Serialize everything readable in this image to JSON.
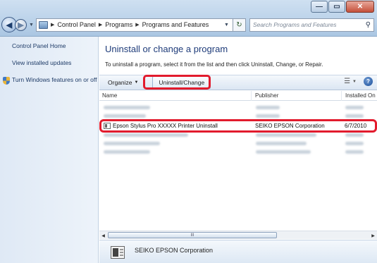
{
  "window": {
    "minimize": "—",
    "maximize": "▭",
    "close": "✕"
  },
  "address": {
    "crumbs": [
      "Control Panel",
      "Programs",
      "Programs and Features"
    ],
    "search_placeholder": "Search Programs and Features"
  },
  "sidebar": {
    "home": "Control Panel Home",
    "updates": "View installed updates",
    "features": "Turn Windows features on or off"
  },
  "main": {
    "heading": "Uninstall or change a program",
    "description": "To uninstall a program, select it from the list and then click Uninstall, Change, or Repair."
  },
  "toolbar": {
    "organize": "Organize",
    "uninstall_change": "Uninstall/Change"
  },
  "columns": {
    "name": "Name",
    "publisher": "Publisher",
    "installed_on": "Installed On"
  },
  "programs": [
    {
      "name": "Epson Stylus Pro XXXXX Printer Uninstall",
      "publisher": "SEIKO EPSON Corporation",
      "installed_on": "6/7/2010"
    }
  ],
  "scrollbar": {
    "grip": "III"
  },
  "details": {
    "publisher": "SEIKO EPSON Corporation"
  },
  "colors": {
    "highlight": "#e21b2d",
    "heading": "#1e3b79"
  }
}
